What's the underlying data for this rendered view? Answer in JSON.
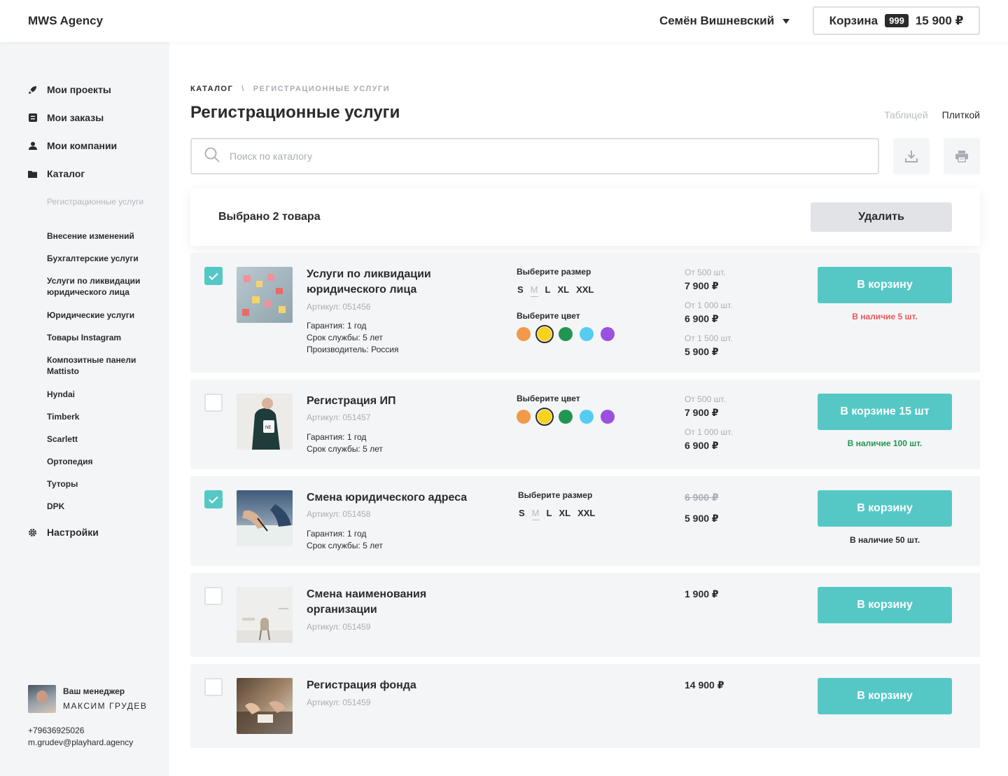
{
  "header": {
    "logo": "MWS Agency",
    "user_name": "Семён Вишневский",
    "cart": {
      "label": "Корзина",
      "count": "999",
      "total": "15 900 ₽"
    }
  },
  "sidebar": {
    "nav": [
      {
        "label": "Мои проекты",
        "icon": "rocket-icon"
      },
      {
        "label": "Мои заказы",
        "icon": "list-icon"
      },
      {
        "label": "Мои компании",
        "icon": "user-icon"
      },
      {
        "label": "Каталог",
        "icon": "folder-icon"
      }
    ],
    "catalog_items": [
      "Регистрационные услуги",
      "Внесение изменений",
      "Бухгалтерские услуги",
      "Услуги по ликвидации юридического лица",
      "Юридические услуги",
      "Товары Instagram",
      "Композитные панели Mattisto",
      "Hyndai",
      "Timberk",
      "Scarlett",
      "Ортопедия",
      "Туторы",
      "DPK"
    ],
    "settings": {
      "label": "Настройки",
      "icon": "gear-icon"
    },
    "manager": {
      "label": "Ваш менеджер",
      "name": "МАКСИМ ГРУДЕВ",
      "phone": "+79636925026",
      "email": "m.grudev@playhard.agency"
    }
  },
  "main": {
    "breadcrumb": {
      "root": "КАТАЛОГ",
      "separator": "\\",
      "current": "РЕГИСТРАЦИОННЫЕ УСЛУГИ"
    },
    "title": "Регистрационные услуги",
    "view_toggle": {
      "table": "Таблицей",
      "tiles": "Плиткой"
    },
    "search": {
      "placeholder": "Поиск по каталогу",
      "value": ""
    },
    "selection": {
      "text": "Выбрано 2 товара",
      "delete_label": "Удалить"
    },
    "labels": {
      "choose_size": "Выберите размер",
      "choose_color": "Выберите цвет"
    },
    "sizes": [
      "S",
      "M",
      "L",
      "XL",
      "XXL"
    ],
    "colors": [
      "#f2994a",
      "#f8d21c",
      "#219653",
      "#56ccf2",
      "#9b51e0"
    ],
    "accent": "#55c8c6",
    "products": [
      {
        "title": "Услуги по ликвидации юридического лица",
        "sku": "Артикул: 051456",
        "specs": [
          "Гарантия: 1 год",
          "Срок службы: 5 лет",
          "Производитель: Россия"
        ],
        "checked": true,
        "prices": [
          {
            "caption": "От 500 шт.",
            "value": "7 900 ₽"
          },
          {
            "caption": "От 1 000 шт.",
            "value": "6 900 ₽"
          },
          {
            "caption": "От 1 500 шт.",
            "value": "5 900 ₽"
          }
        ],
        "button": "В корзину",
        "stock": "В наличие 5 шт.",
        "stock_color": "#eb5757"
      },
      {
        "title": "Регистрация ИП",
        "sku": "Артикул: 051457",
        "specs": [
          "Гарантия: 1 год",
          "Срок службы: 5 лет"
        ],
        "checked": false,
        "prices": [
          {
            "caption": "От 500 шт.",
            "value": "7 900 ₽"
          },
          {
            "caption": "От 1 000 шт.",
            "value": "6 900 ₽"
          }
        ],
        "button": "В корзине 15 шт",
        "stock": "В наличие 100 шт.",
        "stock_color": "#219653"
      },
      {
        "title": "Смена юридического адреса",
        "sku": "Артикул: 051458",
        "specs": [
          "Гарантия: 1 год",
          "Срок службы: 5 лет"
        ],
        "checked": true,
        "old_price": "6 900 ₽",
        "price": "5 900 ₽",
        "button": "В корзину",
        "stock": "В наличие 50 шт.",
        "stock_color": "#2b2b2b"
      },
      {
        "title": "Смена наименования организации",
        "sku": "Артикул: 051459",
        "checked": false,
        "price": "1 900 ₽",
        "button": "В корзину"
      },
      {
        "title": "Регистрация фонда",
        "sku": "Артикул: 051459",
        "checked": false,
        "price": "14 900 ₽",
        "button": "В корзину"
      }
    ]
  }
}
